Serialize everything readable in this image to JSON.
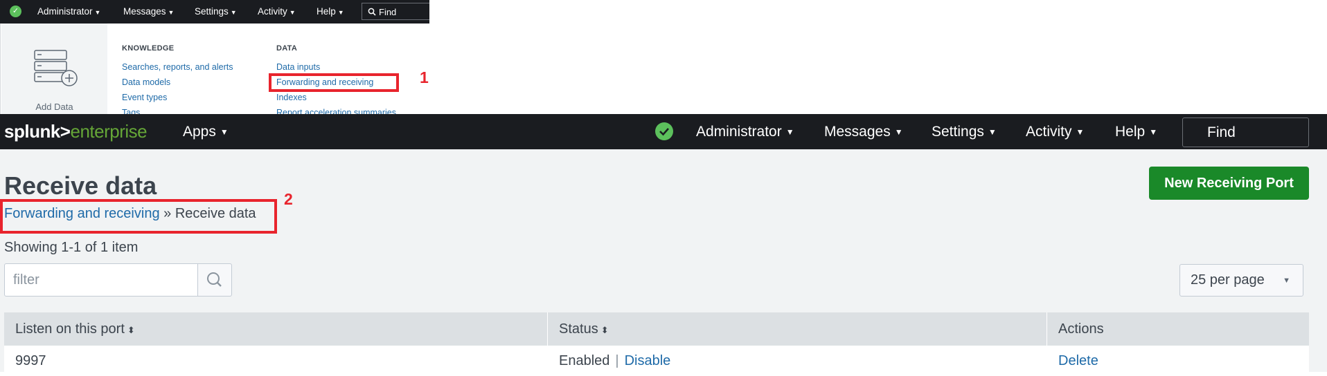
{
  "mini": {
    "nav": [
      "Administrator",
      "Messages",
      "Settings",
      "Activity",
      "Help"
    ],
    "find": "Find",
    "add_data": "Add Data",
    "knowledge": {
      "heading": "KNOWLEDGE",
      "links": [
        "Searches, reports, and alerts",
        "Data models",
        "Event types",
        "Tags"
      ]
    },
    "data": {
      "heading": "DATA",
      "links": [
        "Data inputs",
        "Forwarding and receiving",
        "Indexes",
        "Report acceleration summaries"
      ]
    },
    "annotation": "1"
  },
  "header": {
    "logo_brand": "splunk>",
    "logo_product": "enterprise",
    "apps": "Apps",
    "nav": [
      "Administrator",
      "Messages",
      "Settings",
      "Activity",
      "Help"
    ],
    "find": "Find"
  },
  "page": {
    "title": "Receive data",
    "breadcrumb_link": "Forwarding and receiving",
    "breadcrumb_sep": "»",
    "breadcrumb_current": "Receive data",
    "annotation": "2",
    "showing": "Showing 1-1 of 1 item",
    "filter_placeholder": "filter",
    "new_button": "New Receiving Port",
    "per_page": "25 per page"
  },
  "table": {
    "columns": [
      "Listen on this port",
      "Status",
      "Actions"
    ],
    "rows": [
      {
        "port": "9997",
        "status": "Enabled",
        "toggle": "Disable",
        "action": "Delete"
      }
    ]
  },
  "colors": {
    "accent_green": "#1a8929",
    "annotation_red": "#e8242d",
    "link_blue": "#1e6aa8",
    "header_dark": "#1a1c20"
  }
}
